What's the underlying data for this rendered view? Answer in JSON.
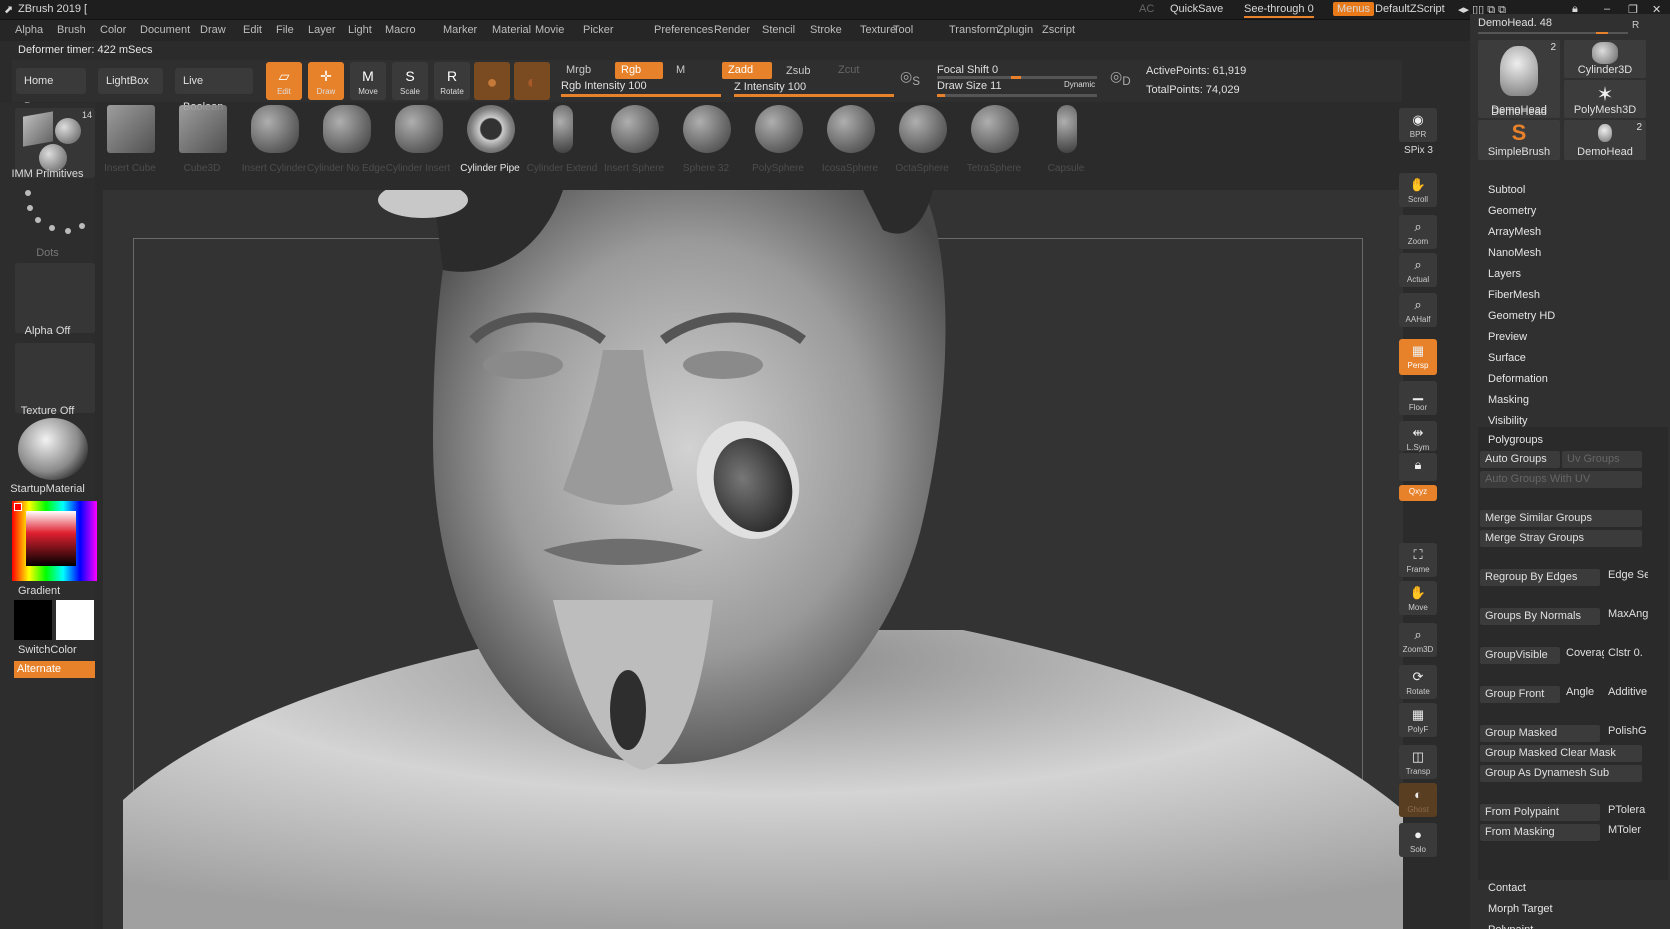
{
  "app": {
    "title": "ZBrush 2019 [",
    "ac": "AC",
    "quicksave": "QuickSave",
    "see_through": "See-through",
    "see_through_value": "0",
    "menus": "Menus",
    "script": "DefaultZScript"
  },
  "menubar": [
    "Alpha",
    "Brush",
    "Color",
    "Document",
    "Draw",
    "Edit",
    "File",
    "Layer",
    "Light",
    "Macro",
    "Marker",
    "Material",
    "Movie",
    "Picker",
    "Preferences",
    "Render",
    "Stencil",
    "Stroke",
    "Texture",
    "Tool",
    "Transform",
    "Zplugin",
    "Zscript"
  ],
  "status": "Deformer timer: 422 mSecs",
  "shelf": {
    "tabs": [
      "Home Page",
      "LightBox",
      "Live Boolean"
    ],
    "tools": [
      {
        "label": "Edit",
        "icon": "edit-icon",
        "active": true
      },
      {
        "label": "Draw",
        "icon": "draw-icon",
        "active": true
      },
      {
        "label": "Move",
        "icon": "move-icon",
        "active": false
      },
      {
        "label": "Scale",
        "icon": "scale-icon",
        "active": false
      },
      {
        "label": "Rotate",
        "icon": "rotate-icon",
        "active": false
      }
    ],
    "mrgb": "Mrgb",
    "rgb": "Rgb",
    "m": "M",
    "zadd": "Zadd",
    "zsub": "Zsub",
    "zcut": "Zcut",
    "rgb_intensity_label": "Rgb Intensity 100",
    "rgb_intensity": 100,
    "z_intensity_label": "Z Intensity 100",
    "z_intensity": 100,
    "focal_shift_label": "Focal Shift 0",
    "focal_shift": 0,
    "draw_size_label": "Draw Size 11",
    "draw_size": 11,
    "dynamic": "Dynamic",
    "active_points": "ActivePoints: 61,919",
    "total_points": "TotalPoints: 74,029",
    "s_key": "S",
    "d_key": "D"
  },
  "primitives": [
    {
      "label": "Insert Cube",
      "shape": "box",
      "highlight": false
    },
    {
      "label": "Cube3D",
      "shape": "box",
      "highlight": false
    },
    {
      "label": "Insert Cylinder",
      "shape": "cyl",
      "highlight": false
    },
    {
      "label": "Cylinder No Edge",
      "shape": "cyl",
      "highlight": false
    },
    {
      "label": "Cylinder Insert",
      "shape": "cyl",
      "highlight": false
    },
    {
      "label": "Cylinder Pipe",
      "shape": "pipe",
      "highlight": true
    },
    {
      "label": "Cylinder Extend",
      "shape": "capsule",
      "highlight": false
    },
    {
      "label": "Insert Sphere",
      "shape": "sphere",
      "highlight": false
    },
    {
      "label": "Sphere 32",
      "shape": "sphere",
      "highlight": false
    },
    {
      "label": "PolySphere",
      "shape": "sphere",
      "highlight": false
    },
    {
      "label": "IcosaSphere",
      "shape": "sphere",
      "highlight": false
    },
    {
      "label": "OctaSphere",
      "shape": "sphere",
      "highlight": false
    },
    {
      "label": "TetraSphere",
      "shape": "sphere",
      "highlight": false
    },
    {
      "label": "Capsule",
      "shape": "capsule",
      "highlight": false
    }
  ],
  "lefttray": {
    "imm": "IMM Primitives",
    "imm_count": "14",
    "dots": "Dots",
    "alpha": "Alpha Off",
    "texture": "Texture Off",
    "material": "StartupMaterial",
    "gradient": "Gradient",
    "switchcolor": "SwitchColor",
    "alternate": "Alternate",
    "primary_color": "#000000",
    "secondary_color": "#ffffff"
  },
  "vtool": [
    {
      "label": "BPR",
      "icon": "bpr-icon",
      "state": "normal"
    },
    {
      "label": "SPix 3",
      "icon": "spix-icon",
      "state": "text"
    },
    {
      "label": "Scroll",
      "icon": "scroll-icon",
      "state": "normal"
    },
    {
      "label": "Zoom",
      "icon": "zoom-icon",
      "state": "normal"
    },
    {
      "label": "Actual",
      "icon": "actual-icon",
      "state": "normal"
    },
    {
      "label": "AAHalf",
      "icon": "aahalf-icon",
      "state": "normal"
    },
    {
      "label": "Persp",
      "icon": "persp-icon",
      "state": "active"
    },
    {
      "label": "Floor",
      "icon": "floor-icon",
      "state": "normal"
    },
    {
      "label": "L.Sym",
      "icon": "lsym-icon",
      "state": "normal"
    },
    {
      "label": "",
      "icon": "lock-icon",
      "state": "normal"
    },
    {
      "label": "Qxyz",
      "icon": "xyz-icon",
      "state": "active"
    },
    {
      "label": "Frame",
      "icon": "frame-icon",
      "state": "normal"
    },
    {
      "label": "Move",
      "icon": "move-icon",
      "state": "normal"
    },
    {
      "label": "Zoom3D",
      "icon": "zoom3d-icon",
      "state": "normal"
    },
    {
      "label": "Rotate",
      "icon": "rotate-icon",
      "state": "normal"
    },
    {
      "label": "PolyF",
      "icon": "polyf-icon",
      "state": "normal"
    },
    {
      "label": "Transp",
      "icon": "transp-icon",
      "state": "normal"
    },
    {
      "label": "Ghost",
      "icon": "ghost-icon",
      "state": "dim"
    },
    {
      "label": "Solo",
      "icon": "solo-icon",
      "state": "normal"
    }
  ],
  "rpanel": {
    "demohead_slider": "DemoHead. 48",
    "r": "R",
    "subtools": [
      {
        "label": "DemoHead",
        "count": "2"
      },
      {
        "label": "Cylinder3D",
        "count": ""
      },
      {
        "label": "DemoHead",
        "count": ""
      },
      {
        "label": "PolyMesh3D",
        "count": ""
      },
      {
        "label": "SimpleBrush",
        "count": ""
      },
      {
        "label": "DemoHead",
        "count": "2"
      }
    ],
    "menus": [
      "Subtool",
      "Geometry",
      "ArrayMesh",
      "NanoMesh",
      "Layers",
      "FiberMesh",
      "Geometry HD",
      "Preview",
      "Surface",
      "Deformation",
      "Masking",
      "Visibility"
    ],
    "polygroups_title": "Polygroups",
    "auto_groups": "Auto Groups",
    "uv_groups": "Uv Groups",
    "auto_groups_uv": "Auto Groups With UV",
    "merge_similar": "Merge Similar Groups",
    "merge_stray": "Merge Stray Groups",
    "regroup_edges": "Regroup By Edges",
    "edge_se": "Edge Se",
    "groups_normals": "Groups By Normals",
    "maxang": "MaxAng",
    "groupvisible": "GroupVisible",
    "coverage": "Coverag",
    "clstr": "Clstr 0.",
    "group_front": "Group Front",
    "angle": "Angle",
    "additive": "Additive",
    "group_masked": "Group Masked",
    "polishg": "PolishG",
    "group_masked_clear": "Group Masked Clear Mask",
    "group_dynamesh": "Group As Dynamesh Sub",
    "from_polypaint": "From Polypaint",
    "ptolera": "PTolera",
    "from_masking": "From Masking",
    "mtoler": "MToler",
    "bottom_menus": [
      "Contact",
      "Morph Target",
      "Polypaint"
    ]
  },
  "colors": {
    "accent": "#e8822a",
    "bg": "#2b2b2b",
    "panel": "#303030"
  }
}
